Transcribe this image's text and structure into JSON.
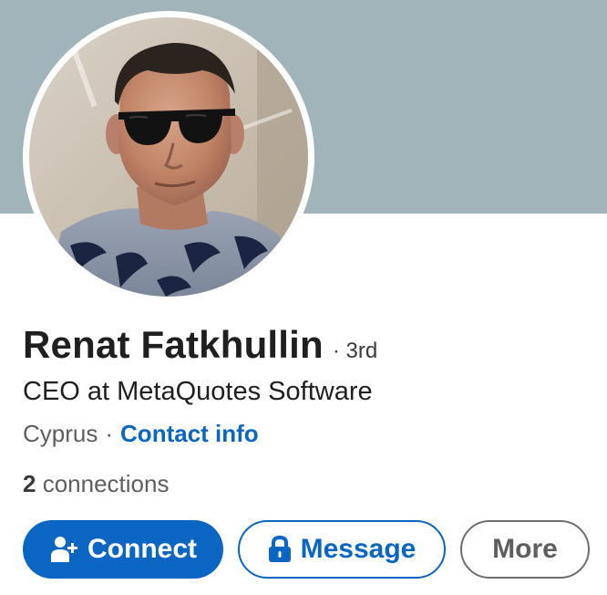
{
  "profile": {
    "name": "Renat Fatkhullin",
    "degree": "· 3rd",
    "headline": "CEO at MetaQuotes Software",
    "location": "Cyprus",
    "separator": "·",
    "contact_info_label": "Contact info",
    "connections_count": "2",
    "connections_label": "connections",
    "avatar_icon": "profile-photo"
  },
  "actions": {
    "connect_label": "Connect",
    "connect_icon": "person-add-icon",
    "message_label": "Message",
    "message_icon": "lock-icon",
    "more_label": "More"
  },
  "colors": {
    "cover": "#a0b4b9",
    "brand_blue": "#0a66c2",
    "text_primary": "#1f1f1f",
    "text_secondary": "#5e5e5e"
  }
}
